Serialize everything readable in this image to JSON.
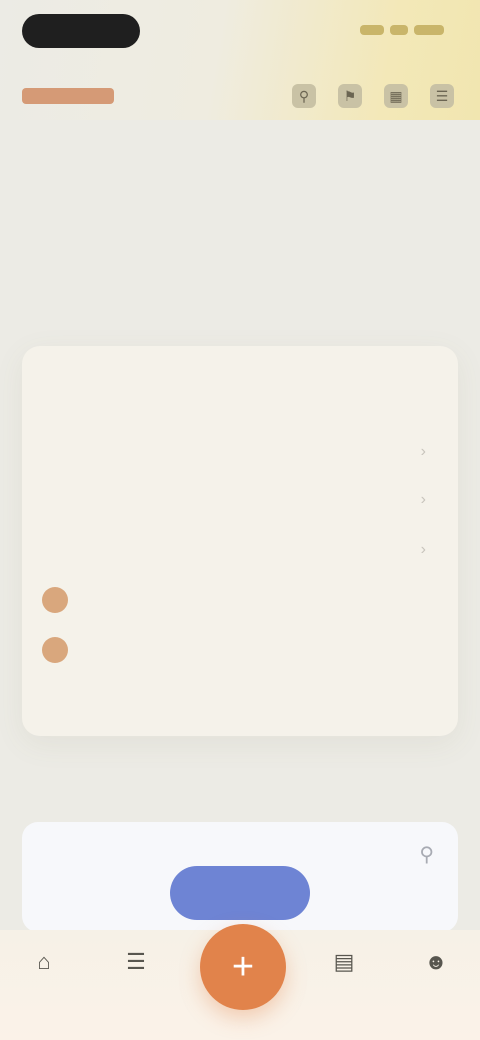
{
  "header": {
    "brand": "",
    "icons": [
      "search-icon",
      "bell-icon",
      "calendar-icon",
      "menu-icon"
    ]
  },
  "page": {
    "title": ""
  },
  "card": {
    "label": "",
    "active_item": "",
    "sub_items": [
      "",
      "",
      ""
    ],
    "tags": [
      "",
      ""
    ],
    "more_link": ""
  },
  "section": {
    "title": ""
  },
  "search": {
    "placeholder": "",
    "cta_label": "",
    "mini_label": ""
  },
  "bottom_nav": {
    "items": [
      "home-icon",
      "list-icon",
      "add-icon",
      "chart-icon",
      "profile-icon"
    ]
  },
  "colors": {
    "accent": "#e1834b",
    "primary_button": "#6e84d4",
    "brand": "#d59a76"
  }
}
